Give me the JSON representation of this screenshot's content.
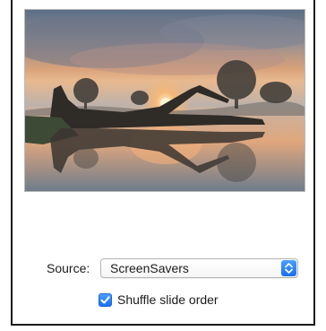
{
  "preview": {
    "image_description_icon": "landscape-photo-icon"
  },
  "source": {
    "label": "Source:",
    "selected_value": "ScreenSavers",
    "stepper_icon": "up-down-chevron-icon"
  },
  "shuffle": {
    "label": "Shuffle slide order",
    "checked": true
  },
  "colors": {
    "accent": "#1a6ff0",
    "border": "#1a1a1a"
  }
}
